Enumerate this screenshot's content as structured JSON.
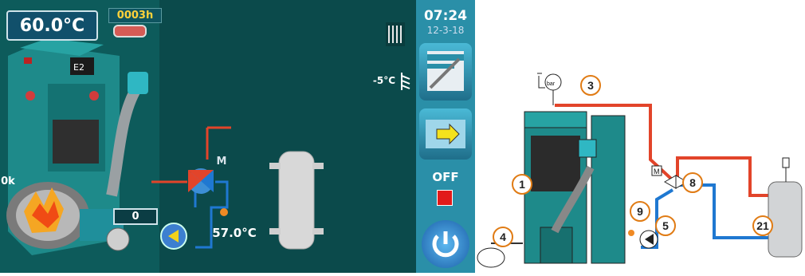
{
  "screen": {
    "boiler_temp": "60.0°C",
    "hours_counter": "0003h",
    "clock_time": "07:24",
    "clock_date": "12-3-18",
    "outdoor_temp": "-5°C",
    "flow_temp": "57.0°C",
    "fuel_level": "0",
    "power_label": "0k",
    "mixer_label": "M",
    "state_label": "OFF"
  },
  "icons": {
    "heater": "radiator-icon",
    "settings": "settings-icon",
    "manual": "manual-mode-icon",
    "stop": "stop-icon",
    "power": "power-icon",
    "pump": "pump-icon",
    "mixer": "mixing-valve-icon",
    "buffer": "buffer-tank-icon"
  },
  "diagram": {
    "callouts": [
      "1",
      "3",
      "4",
      "5",
      "8",
      "9",
      "21"
    ],
    "mixer_label": "M",
    "pressure_label": "bar"
  },
  "colors": {
    "panel_bg": "#0b4a4b",
    "sidebar": "#2a8fa8",
    "hot_pipe": "#e2442a",
    "cold_pipe": "#1f78d1",
    "accent": "#e07b14"
  }
}
